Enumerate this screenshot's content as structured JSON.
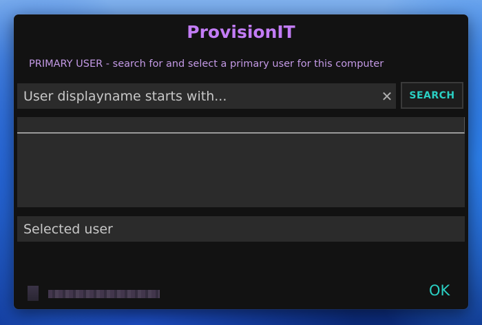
{
  "dialog": {
    "title": "ProvisionIT",
    "subtitle": "PRIMARY USER - search for and select a primary user for this computer"
  },
  "search": {
    "placeholder": "User displayname starts with...",
    "value": "",
    "clear_icon": "close-icon",
    "button_label": "SEARCH"
  },
  "results": {
    "items": []
  },
  "selected_user": {
    "label": "Selected user"
  },
  "footer": {
    "ok_label": "OK"
  },
  "colors": {
    "title": "#c27cf5",
    "subtitle": "#c49ae6",
    "accent": "#2ad0c4",
    "dialog_bg": "#121212",
    "field_bg": "#2b2b2b"
  }
}
